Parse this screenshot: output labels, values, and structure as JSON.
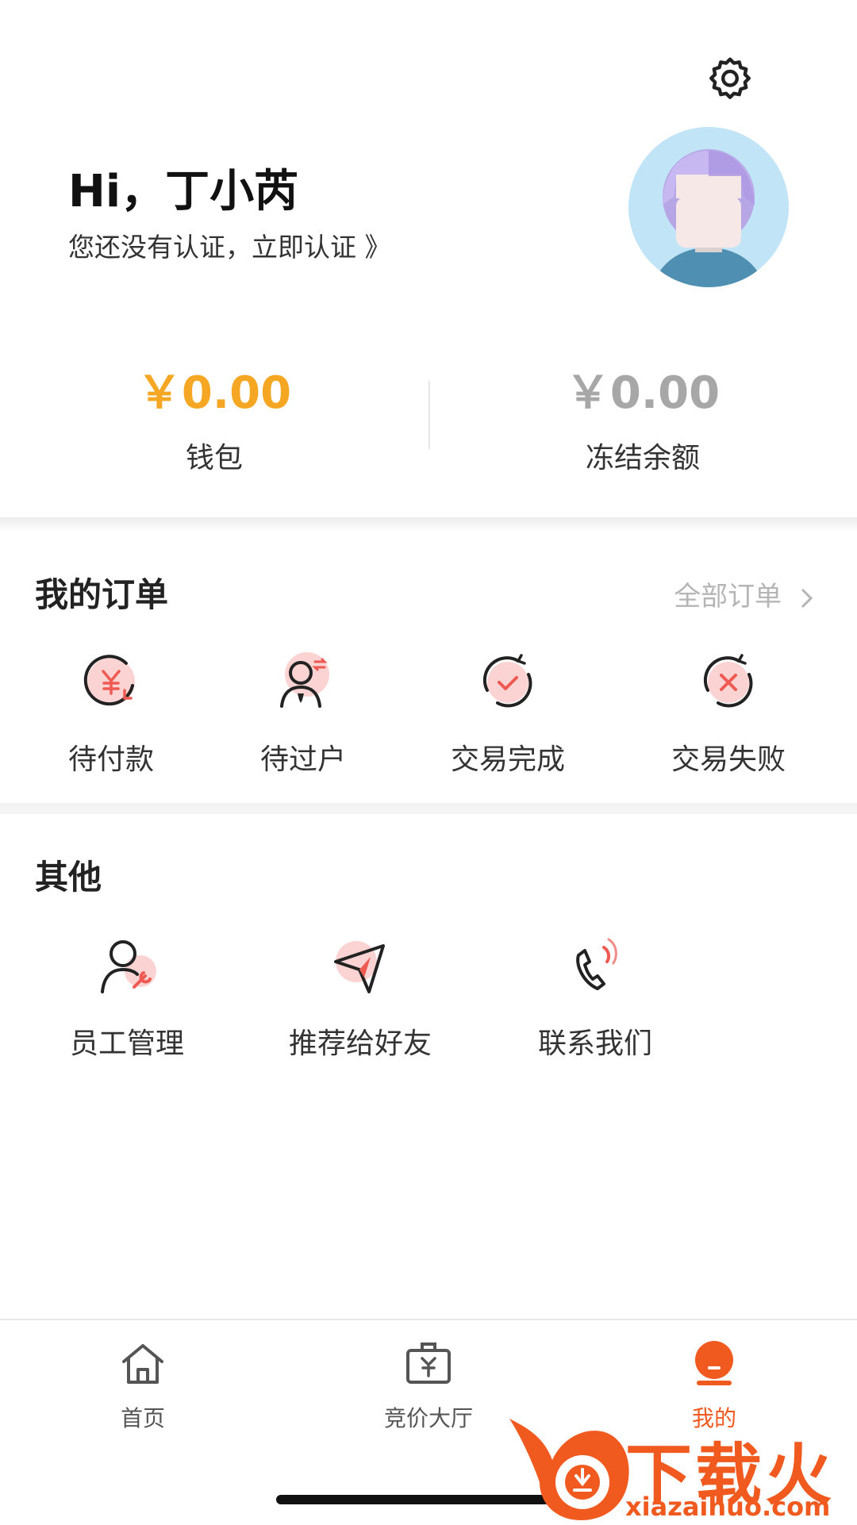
{
  "header": {
    "greeting": "Hi，丁小芮",
    "verify_prompt": "您还没有认证，立即认证 》"
  },
  "balance": {
    "wallet_amount": "￥0.00",
    "wallet_label": "钱包",
    "frozen_amount": "￥0.00",
    "frozen_label": "冻结余额"
  },
  "orders": {
    "title": "我的订单",
    "all_link": "全部订单",
    "items": [
      {
        "label": "待付款",
        "icon": "pending-payment-icon"
      },
      {
        "label": "待过户",
        "icon": "pending-transfer-icon"
      },
      {
        "label": "交易完成",
        "icon": "trade-complete-icon"
      },
      {
        "label": "交易失败",
        "icon": "trade-failed-icon"
      }
    ]
  },
  "others": {
    "title": "其他",
    "items": [
      {
        "label": "员工管理",
        "icon": "staff-management-icon"
      },
      {
        "label": "推荐给好友",
        "icon": "recommend-icon"
      },
      {
        "label": "联系我们",
        "icon": "phone-icon"
      }
    ]
  },
  "tabbar": {
    "items": [
      {
        "label": "首页",
        "icon": "home-icon"
      },
      {
        "label": "竞价大厅",
        "icon": "bidding-hall-icon"
      },
      {
        "label": "我的",
        "icon": "profile-icon",
        "active": true
      }
    ]
  },
  "watermark": {
    "brand": "下载火",
    "url": "xiazaihuo.com"
  },
  "colors": {
    "accent_orange": "#f5a623",
    "muted_gray": "#9e9e9e",
    "icon_pink": "#fcd3d3",
    "icon_red": "#ee5a52",
    "brand_orange": "#f05a1f"
  }
}
